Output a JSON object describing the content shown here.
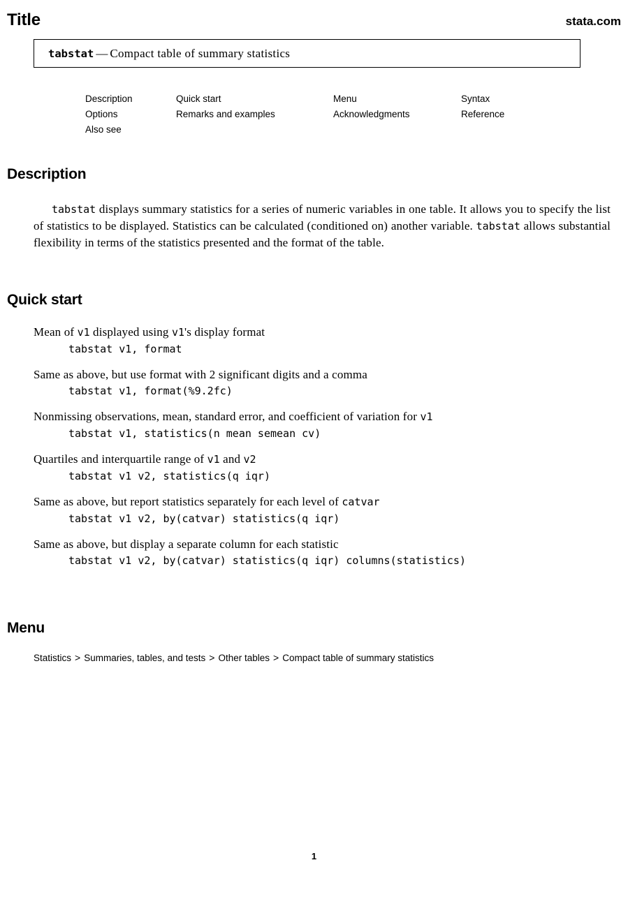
{
  "header": {
    "title": "Title",
    "site": "stata.com"
  },
  "title_box": {
    "command": "tabstat",
    "dash": "—",
    "description": "Compact table of summary statistics"
  },
  "nav_links": [
    [
      {
        "label": "Description"
      },
      {
        "label": "Quick start"
      },
      {
        "label": "Menu"
      },
      {
        "label": "Syntax"
      }
    ],
    [
      {
        "label": "Options"
      },
      {
        "label": "Remarks and examples"
      },
      {
        "label": "Acknowledgments"
      },
      {
        "label": "Reference"
      }
    ],
    [
      {
        "label": "Also see"
      },
      {
        "label": ""
      },
      {
        "label": ""
      },
      {
        "label": ""
      }
    ]
  ],
  "sections": {
    "description": {
      "heading": "Description",
      "paragraph_parts": [
        {
          "type": "mono",
          "text": "tabstat"
        },
        {
          "type": "text",
          "text": " displays summary statistics for a series of numeric variables in one table. It allows you to specify the list of statistics to be displayed. Statistics can be calculated (conditioned on) another variable. "
        },
        {
          "type": "mono",
          "text": "tabstat"
        },
        {
          "type": "text",
          "text": " allows substantial flexibility in terms of the statistics presented and the format of the table."
        }
      ]
    },
    "quick_start": {
      "heading": "Quick start",
      "entries": [
        {
          "desc_parts": [
            {
              "type": "text",
              "text": "Mean of "
            },
            {
              "type": "mono",
              "text": "v1"
            },
            {
              "type": "text",
              "text": " displayed using "
            },
            {
              "type": "mono",
              "text": "v1"
            },
            {
              "type": "text",
              "text": "'s display format"
            }
          ],
          "command": "tabstat v1, format"
        },
        {
          "desc_parts": [
            {
              "type": "text",
              "text": "Same as above, but use format with 2 significant digits and a comma"
            }
          ],
          "command": "tabstat v1, format(%9.2fc)"
        },
        {
          "desc_parts": [
            {
              "type": "text",
              "text": "Nonmissing observations, mean, standard error, and coefficient of variation for "
            },
            {
              "type": "mono",
              "text": "v1"
            }
          ],
          "command": "tabstat v1, statistics(n mean semean cv)"
        },
        {
          "desc_parts": [
            {
              "type": "text",
              "text": "Quartiles and interquartile range of "
            },
            {
              "type": "mono",
              "text": "v1"
            },
            {
              "type": "text",
              "text": " and "
            },
            {
              "type": "mono",
              "text": "v2"
            }
          ],
          "command": "tabstat v1 v2, statistics(q iqr)"
        },
        {
          "desc_parts": [
            {
              "type": "text",
              "text": "Same as above, but report statistics separately for each level of "
            },
            {
              "type": "mono",
              "text": "catvar"
            }
          ],
          "command": "tabstat v1 v2, by(catvar) statistics(q iqr)"
        },
        {
          "desc_parts": [
            {
              "type": "text",
              "text": "Same as above, but display a separate column for each statistic"
            }
          ],
          "command": "tabstat v1 v2, by(catvar) statistics(q iqr) columns(statistics)"
        }
      ]
    },
    "menu": {
      "heading": "Menu",
      "separator": ">",
      "path": [
        "Statistics",
        "Summaries, tables, and tests",
        "Other tables",
        "Compact table of summary statistics"
      ]
    }
  },
  "footer": {
    "page_number": "1"
  }
}
